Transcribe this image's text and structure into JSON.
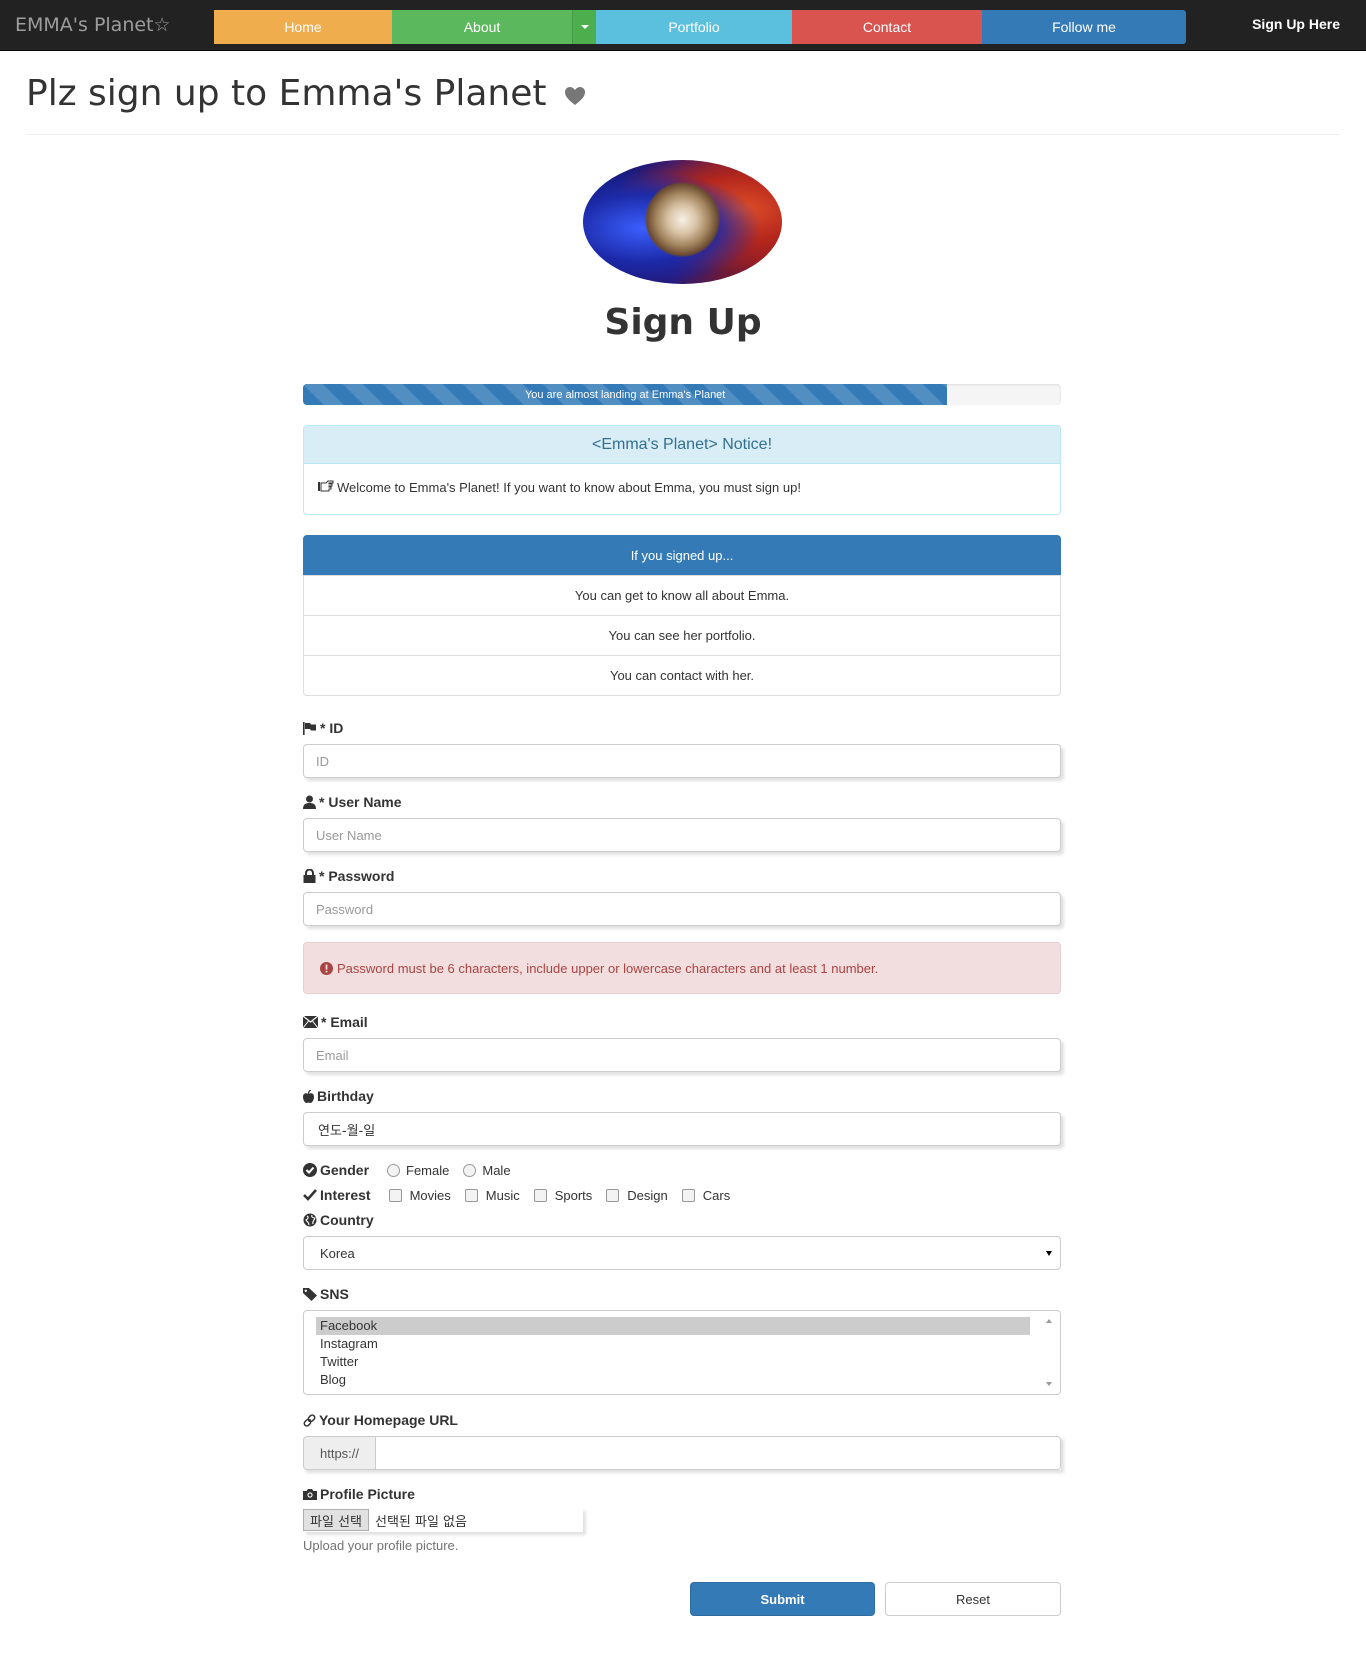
{
  "navbar": {
    "brand": "EMMA's Planet☆",
    "items": [
      {
        "label": "Home",
        "color": "#f0ad4e"
      },
      {
        "label": "About",
        "color": "#5cb85c"
      },
      {
        "label": "Portfolio",
        "color": "#5bc0de"
      },
      {
        "label": "Contact",
        "color": "#d9534f"
      },
      {
        "label": "Follow me",
        "color": "#337ab7"
      }
    ],
    "signup_link": "Sign Up Here"
  },
  "header": {
    "title": "Plz sign up to Emma's Planet",
    "title_icon": "heart-icon"
  },
  "signup_heading": "Sign Up",
  "progress": {
    "label": "You are almost landing at Emma's Planet",
    "percent": 85
  },
  "notice": {
    "title": "<Emma's Planet> Notice!",
    "icon": "hand-pointing-icon",
    "text": "Welcome to Emma's Planet! If you want to know about Emma, you must sign up!"
  },
  "benefits": {
    "title": "If you signed up...",
    "items": [
      "You can get to know all about Emma.",
      "You can see her portfolio.",
      "You can contact with her."
    ]
  },
  "form": {
    "id": {
      "label": "* ID",
      "placeholder": "ID",
      "icon": "flag-icon"
    },
    "username": {
      "label": "* User Name",
      "placeholder": "User Name",
      "icon": "user-icon"
    },
    "password": {
      "label": "* Password",
      "placeholder": "Password",
      "icon": "lock-icon"
    },
    "password_alert": "Password must be 6 characters, include upper or lowercase characters and at least 1 number.",
    "email": {
      "label": "* Email",
      "placeholder": "Email",
      "icon": "envelope-icon"
    },
    "birthday": {
      "label": "Birthday",
      "placeholder": "연도-월-일",
      "icon": "apple-icon"
    },
    "gender": {
      "label": "Gender",
      "options": [
        "Female",
        "Male"
      ],
      "icon": "check-circle-icon"
    },
    "interest": {
      "label": "Interest",
      "options": [
        "Movies",
        "Music",
        "Sports",
        "Design",
        "Cars"
      ],
      "icon": "checkmark-icon"
    },
    "country": {
      "label": "Country",
      "selected": "Korea",
      "icon": "globe-icon"
    },
    "sns": {
      "label": "SNS",
      "options": [
        "Facebook",
        "Instagram",
        "Twitter",
        "Blog"
      ],
      "selected": "Facebook",
      "icon": "tag-icon"
    },
    "homepage": {
      "label": "Your Homepage URL",
      "prefix": "https://",
      "icon": "link-icon"
    },
    "picture": {
      "label": "Profile Picture",
      "button": "파일 선택",
      "no_file": "선택된 파일 없음",
      "help": "Upload your profile picture.",
      "icon": "camera-icon"
    },
    "submit": "Submit",
    "reset": "Reset"
  }
}
